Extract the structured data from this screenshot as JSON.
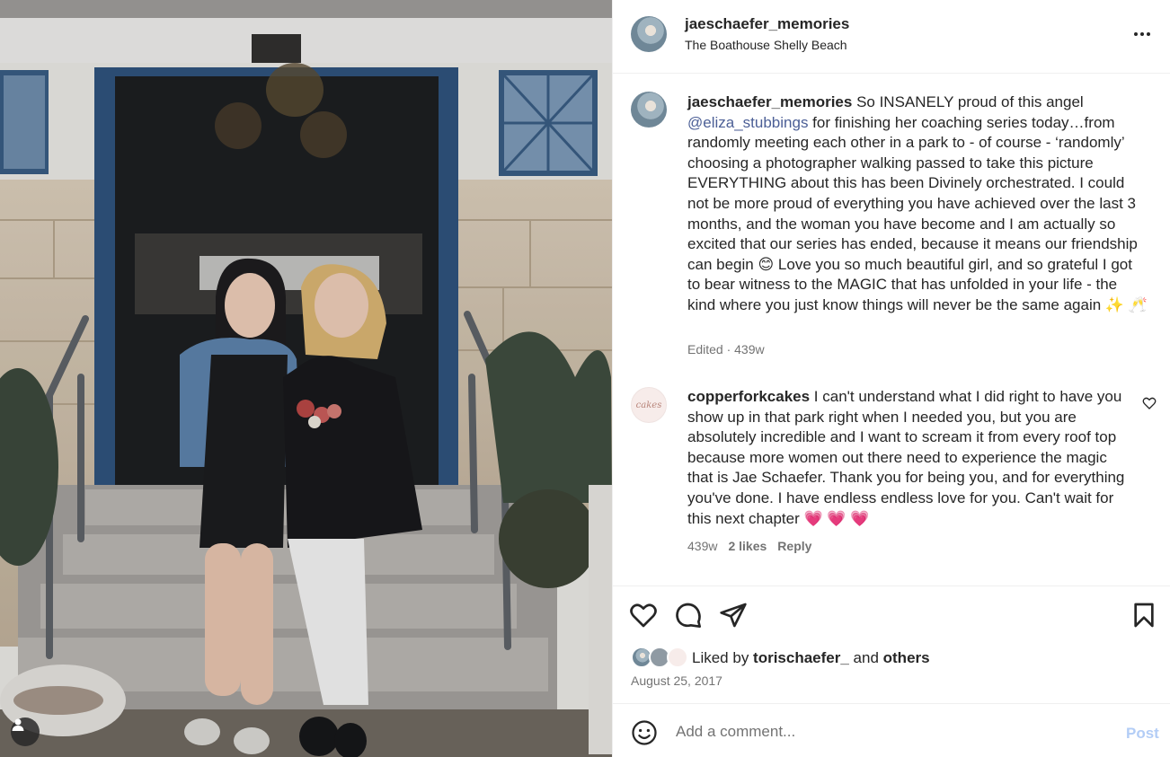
{
  "header": {
    "username": "jaeschaefer_memories",
    "location": "The Boathouse Shelly Beach"
  },
  "caption": {
    "username": "jaeschaefer_memories",
    "text_1": " So INSANELY proud of this angel ",
    "mention": "@eliza_stubbings",
    "text_2": " for finishing her coaching series today…from randomly meeting each other in a park to - of course - ‘randomly’ choosing a photographer walking passed to take this picture EVERYTHING about this has been Divinely orchestrated. I could not be more proud of everything you have achieved over the last 3 months, and the woman you have become and I am actually so excited that our series has ended, because it means our friendship can begin ",
    "emoji_1": "😊",
    "text_3": " Love you so much beautiful girl, and so grateful I got to bear witness to the MAGIC that has unfolded in your life - the kind where you just know things will never be the same again ",
    "emoji_2": "✨ 🥂",
    "meta": "Edited · 439w"
  },
  "comment": {
    "avatar_text": "cakes",
    "username": "copperforkcakes",
    "text": " I can't understand what I did right to have you show up in that park right when I needed you, but you are absolutely incredible and I want to scream it from every roof top because more women out there need to experience the magic that is Jae Schaefer. Thank you for being you, and for everything you've done. I have endless endless love for you. Can't wait for this next chapter ",
    "emoji": "💗 💗 💗",
    "age": "439w",
    "likes": "2 likes",
    "reply": "Reply"
  },
  "likes": {
    "prefix": "Liked by ",
    "user": "torischaefer_",
    "and": " and ",
    "others": "others"
  },
  "date": "August 25, 2017",
  "add_comment": {
    "placeholder": "Add a comment...",
    "post_label": "Post"
  },
  "colors": {
    "text": "#262626",
    "muted": "#737373",
    "mention": "#4c5f96",
    "post_disabled": "#b3cdf6"
  },
  "icons": [
    "more-icon",
    "heart-icon",
    "comment-icon",
    "share-icon",
    "bookmark-icon",
    "emoji-icon",
    "user-tag-icon"
  ]
}
